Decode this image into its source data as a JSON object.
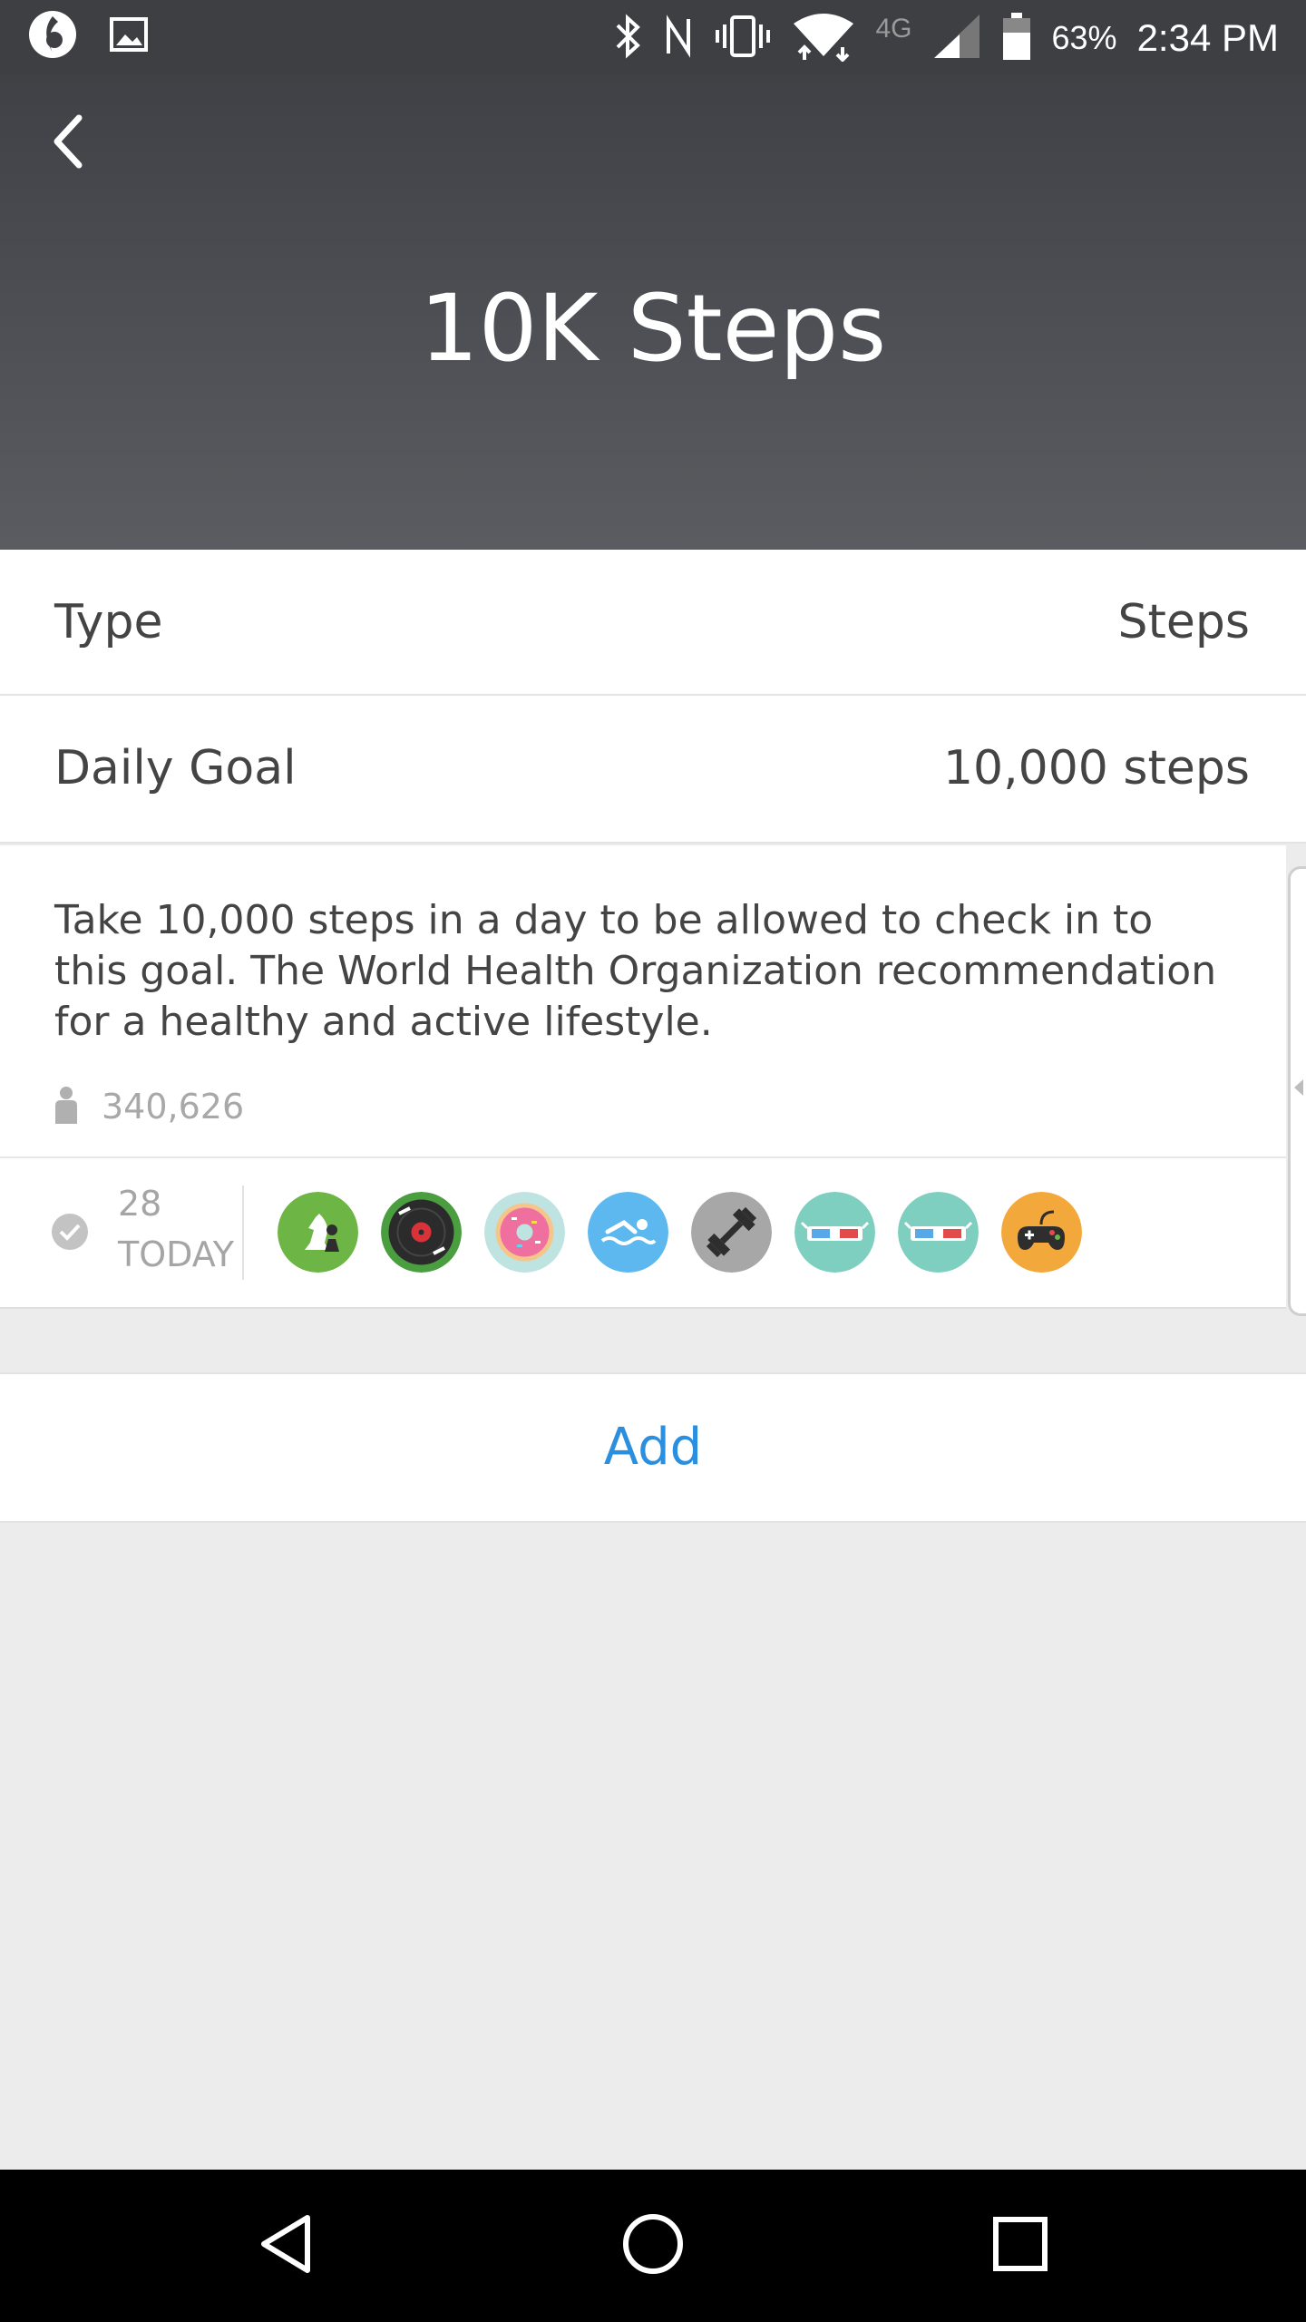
{
  "status_bar": {
    "battery_percent": "63%",
    "network": "4G",
    "time": "2:34 PM",
    "left_icons": [
      "app-notification-icon",
      "image-notification-icon"
    ],
    "right_icons": [
      "bluetooth-icon",
      "nfc-icon",
      "vibrate-icon",
      "wifi-icon",
      "signal-icon",
      "battery-icon"
    ]
  },
  "header": {
    "title": "10K Steps",
    "back_icon": "chevron-left-icon"
  },
  "details": {
    "type_label": "Type",
    "type_value": "Steps",
    "goal_label": "Daily Goal",
    "goal_value": "10,000 steps"
  },
  "description": {
    "text": "Take 10,000 steps in a day to be allowed to check in to this goal. The World Health Organization recommendation for a healthy and active lifestyle.",
    "member_count": "340,626"
  },
  "checkins": {
    "count": "28",
    "label": "TODAY",
    "avatars": [
      {
        "icon": "chess-icon",
        "color": "#6db544"
      },
      {
        "icon": "vinyl-record-icon",
        "color": "#4a9e3f"
      },
      {
        "icon": "donut-icon",
        "color": "#bfe3e0"
      },
      {
        "icon": "swimmer-icon",
        "color": "#5cb8ee"
      },
      {
        "icon": "dumbbell-icon",
        "color": "#a7a7a7"
      },
      {
        "icon": "3d-glasses-icon",
        "color": "#7fcfc0"
      },
      {
        "icon": "3d-glasses-icon",
        "color": "#7fcfc0"
      },
      {
        "icon": "gamepad-icon",
        "color": "#f3a83c"
      }
    ]
  },
  "actions": {
    "add_label": "Add"
  },
  "colors": {
    "accent": "#2b8fe0",
    "header_top": "#3f4146",
    "header_bottom": "#5a5c61"
  }
}
